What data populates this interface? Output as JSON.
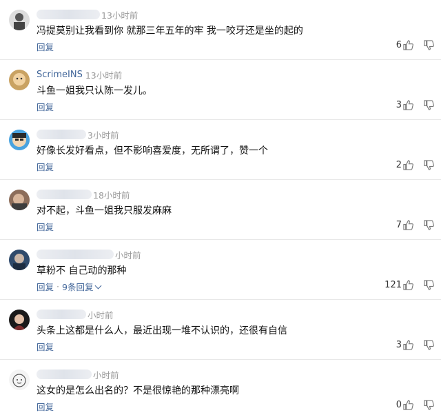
{
  "comments": [
    {
      "user": "",
      "time": "13小时前",
      "text": "冯提莫别让我看到你 就那三年五年的牢 我一咬牙还是坐的起的",
      "reply": "回复",
      "likes": "6",
      "more": ""
    },
    {
      "user": "ScrimeINS",
      "time": "13小时前",
      "text": "斗鱼一姐我只认陈一发儿。",
      "reply": "回复",
      "likes": "3",
      "more": ""
    },
    {
      "user": "",
      "time": "3小时前",
      "text": "好像长发好看点，但不影响喜爱度，无所谓了，赞一个",
      "reply": "回复",
      "likes": "2",
      "more": ""
    },
    {
      "user": "",
      "time": "18小时前",
      "text": "对不起，斗鱼一姐我只服发麻麻",
      "reply": "回复",
      "likes": "7",
      "more": ""
    },
    {
      "user": "",
      "time": "小时前",
      "text": "草粉不 自己动的那种",
      "reply": "回复",
      "likes": "121",
      "more": "9条回复"
    },
    {
      "user": "",
      "time": "小时前",
      "text": "头条上这都是什么人，最近出现一堆不认识的，还很有自信",
      "reply": "回复",
      "likes": "3",
      "more": ""
    },
    {
      "user": "",
      "time": "小时前",
      "text": "这女的是怎么出名的？不是很惊艳的那种漂亮啊",
      "reply": "回复",
      "likes": "0",
      "more": ""
    }
  ],
  "ui": {
    "separator": "·"
  }
}
